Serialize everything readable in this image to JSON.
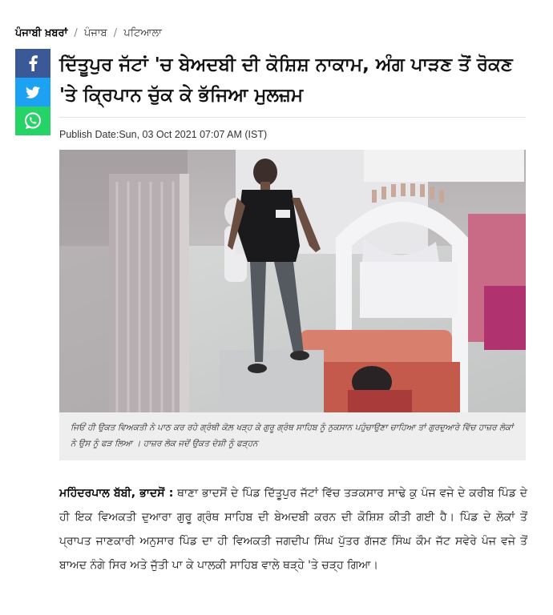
{
  "breadcrumb": {
    "home": "ਪੰਜਾਬੀ ਖ਼ਬਰਾਂ",
    "separator": "/",
    "section": "ਪੰਜਾਬ",
    "subsection": "ਪਟਿਆਲਾ"
  },
  "share": {
    "items": [
      {
        "name": "facebook",
        "icon": "facebook-icon",
        "color": "#3b5998"
      },
      {
        "name": "twitter",
        "icon": "twitter-icon",
        "color": "#1da1f2"
      },
      {
        "name": "whatsapp",
        "icon": "whatsapp-icon",
        "color": "#25d366"
      }
    ]
  },
  "article": {
    "title": "ਦਿੱਤੂਪੁਰ ਜੱਟਾਂ 'ਚ ਬੇਅਦਬੀ ਦੀ ਕੋਸ਼ਿਸ਼ ਨਾਕਾਮ, ਅੰਗ ਪਾੜਣ ਤੋਂ ਰੋਕਣ 'ਤੇ ਕ੍ਰਿਪਾਨ ਚੁੱਕ ਕੇ ਭੱਜਿਆ ਮੁਲਜ਼ਮ",
    "publish_date": "Publish Date:Sun, 03 Oct 2021 07:07 AM (IST)",
    "caption": "ਜਿਓਂ ਹੀ ਉਕਤ ਵਿਅਕਤੀ ਨੇ ਪਾਠ ਕਰ ਰਹੇ ਗ੍ਰੰਥੀ ਕੋਲ਼ ਖੜ੍ਹ ਕੇ ਗੁਰੂ ਗ੍ਰੰਥ ਸਾਹਿਬ ਨੂੰ ਨੁਕਸਾਨ ਪਹੁੰਚਾਉਣਾ ਚਾਹਿਆ ਤਾਂ ਗੁਰਦੁਆਰੇ ਵਿੱਚ ਹਾਜ਼ਰ ਲੋਕਾਂ ਨੇ ਉਸ ਨੂੰ ਫੜ ਲਿਆ । ਹਾਜ਼ਰ ਲੋਕ ਜਦੋਂ ਉਕਤ ਦੋਸ਼ੀ ਨੂੰ ਫੜ੍ਹਨ",
    "author": "ਮਹਿੰਦਰਪਾਲ ਬੱਬੀ, ਭਾਦਸੋਂ :",
    "body": "ਥਾਣਾ ਭਾਦਸੋਂ ਦੇ ਪਿੰਡ ਦਿੱਤੂਪੁਰ ਜੱਟਾਂ ਵਿੱਚ ਤੜਕਸਾਰ ਸਾਢੇ ਕੁ ਪੰਜ ਵਜੇ ਦੇ ਕਰੀਬ ਪਿੰਡ ਦੇ ਹੀ ਇਕ ਵਿਅਕਤੀ ਦੁਆਰਾ ਗੁਰੂ ਗ੍ਰੰਥ ਸਾਹਿਬ ਦੀ ਬੇਅਦਬੀ ਕਰਨ ਦੀ ਕੋਸ਼ਿਸ਼ ਕੀਤੀ ਗਈ ਹੈ। ਪਿੰਡ ਦੇ ਲੋਕਾਂ ਤੋਂ ਪ੍ਰਾਪਤ ਜਾਣਕਾਰੀ ਅਨੁਸਾਰ ਪਿੰਡ ਦਾ ਹੀ ਵਿਅਕਤੀ ਜਗਦੀਪ ਸਿੰਘ ਪੁੱਤਰ ਗੱਜਣ ਸਿੰਘ ਕੌਮ ਜੱਟ ਸਵੇਰੇ ਪੰਜ ਵਜੇ ਤੋਂ ਬਾਅਦ ਨੰਗੇ ਸਿਰ ਅਤੇ ਜੁੱਤੀ ਪਾ ਕੇ ਪਾਲਕੀ ਸਾਹਿਬ ਵਾਲੇ ਥੜ੍ਹੇ 'ਤੇ ਚੜ੍ਹ ਗਿਆ।"
  }
}
